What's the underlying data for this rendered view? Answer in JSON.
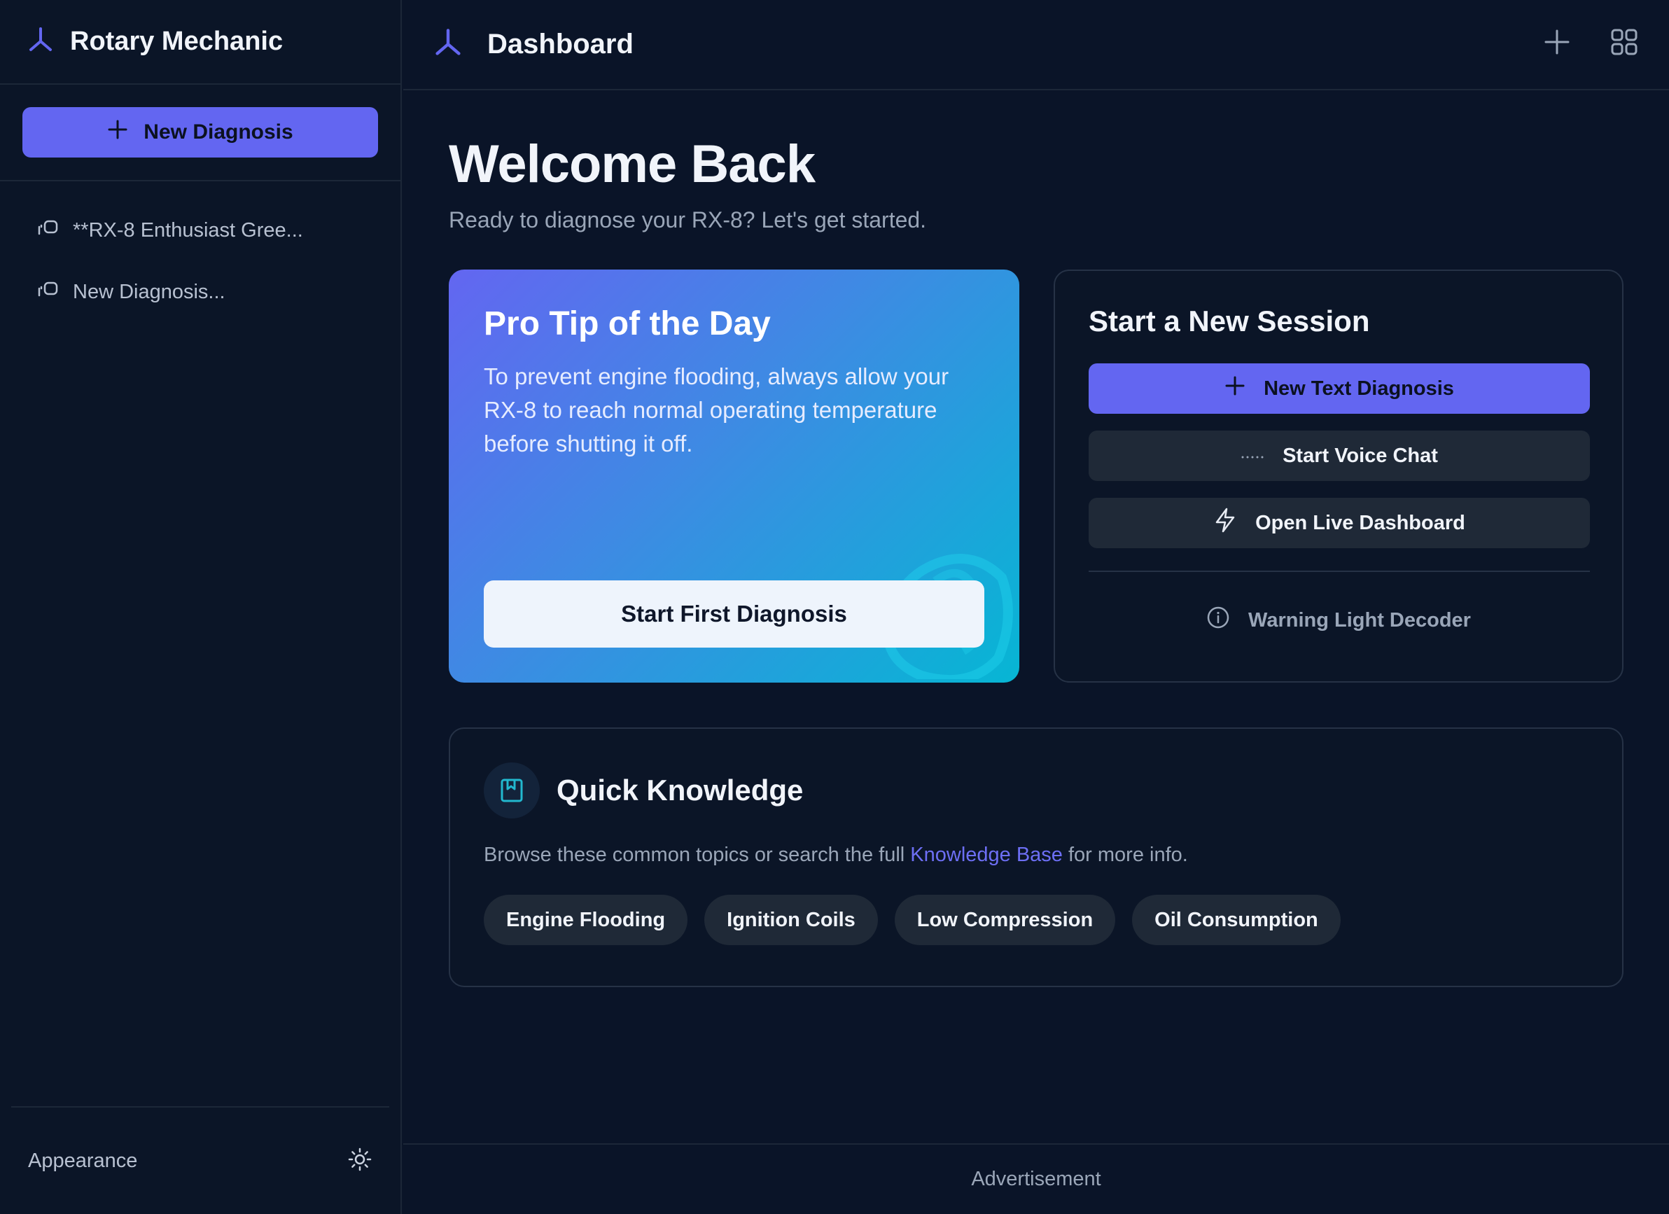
{
  "sidebar": {
    "brand": "Rotary Mechanic",
    "new_diagnosis_label": "New Diagnosis",
    "history": [
      {
        "label": "**RX-8 Enthusiast Gree..."
      },
      {
        "label": "New Diagnosis..."
      }
    ],
    "appearance_label": "Appearance"
  },
  "topbar": {
    "title": "Dashboard"
  },
  "main": {
    "welcome_title": "Welcome Back",
    "welcome_subtitle": "Ready to diagnose your RX-8? Let's get started.",
    "tip": {
      "title": "Pro Tip of the Day",
      "text": "To prevent engine flooding, always allow your RX-8 to reach normal operating temperature before shutting it off.",
      "button_label": "Start First Diagnosis"
    },
    "session": {
      "title": "Start a New Session",
      "text_diagnosis_label": "New Text Diagnosis",
      "voice_chat_label": "Start Voice Chat",
      "live_dashboard_label": "Open Live Dashboard",
      "warning_decoder_label": "Warning Light Decoder"
    },
    "knowledge": {
      "title": "Quick Knowledge",
      "desc_before": "Browse these common topics or search the full ",
      "desc_link": "Knowledge Base",
      "desc_after": " for more info.",
      "topics": [
        "Engine Flooding",
        "Ignition Coils",
        "Low Compression",
        "Oil Consumption"
      ]
    }
  },
  "footer": {
    "ad_label": "Advertisement"
  },
  "colors": {
    "accent": "#6366f1",
    "background": "#0a1428",
    "card_border": "#263246",
    "chip_bg": "#1f2937"
  }
}
